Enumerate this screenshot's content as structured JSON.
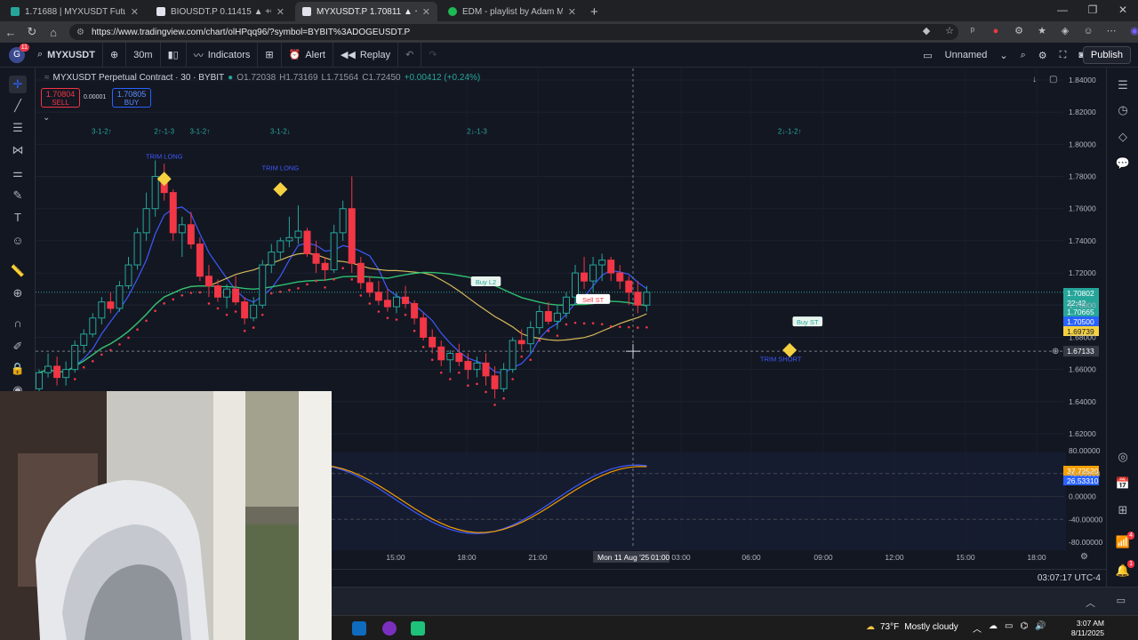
{
  "browser": {
    "tabs": [
      {
        "title": "1.71688 | MYXUSDT Futures Exch...",
        "color": "#26a69a",
        "active": false
      },
      {
        "title": "BIOUSDT.P 0.11415 ▲ +0.22% Un...",
        "color": "#ffffff",
        "active": false
      },
      {
        "title": "MYXUSDT.P 1.70811 ▲ +2.28% U...",
        "color": "#ffffff",
        "active": true
      },
      {
        "title": "EDM - playlist by Adam Moss | Sp...",
        "color": "#1db954",
        "active": false
      }
    ],
    "url": "https://www.tradingview.com/chart/olHPqq96/?symbol=BYBIT%3ADOGEUSDT.P"
  },
  "toolbar": {
    "avatar_letter": "G",
    "avatar_badge": "11",
    "symbol": "MYXUSDT",
    "interval": "30m",
    "indicators": "Indicators",
    "alert": "Alert",
    "replay": "Replay",
    "layout_name": "Unnamed",
    "publish": "Publish"
  },
  "legend": {
    "title": "MYXUSDT Perpetual Contract · 30 · BYBIT",
    "open": "O1.72038",
    "high": "H1.73169",
    "low": "L1.71564",
    "close": "C1.72450",
    "change": "+0.00412 (+0.24%)"
  },
  "trade": {
    "sell_price": "1.70804",
    "sell_label": "SELL",
    "spread": "0.00001",
    "buy_price": "1.70805",
    "buy_label": "BUY"
  },
  "chart_data": {
    "type": "candlestick",
    "price_axis": [
      "1.84000",
      "1.82000",
      "1.80000",
      "1.78000",
      "1.76000",
      "1.74000",
      "1.72000",
      "1.70000",
      "1.68000",
      "1.66000",
      "1.64000",
      "1.62000"
    ],
    "time_axis": [
      "15:00",
      "18:00",
      "21:00",
      "01:00",
      "03:00",
      "06:00",
      "09:00",
      "12:00",
      "15:00",
      "18:00"
    ],
    "crosshair_date": "Mon 11 Aug '25",
    "crosshair_time": "01:00",
    "crosshair_price": "1.67133",
    "price_labels": [
      {
        "value": "1.70802",
        "color": "#26a69a"
      },
      {
        "value": "22:42",
        "color": "#26a69a"
      },
      {
        "value": "1.70665",
        "color": "#26a69a"
      },
      {
        "value": "1.70500",
        "color": "#2962ff"
      },
      {
        "value": "1.69739",
        "color": "#f5d142"
      }
    ],
    "pattern_labels": [
      {
        "text": "3-1-2↑",
        "t": 7,
        "p": 1.8065
      },
      {
        "text": "2↑-1-3",
        "t": 14,
        "p": 1.8065
      },
      {
        "text": "3-1-2↑",
        "t": 18,
        "p": 1.8065
      },
      {
        "text": "3-1-2↓",
        "t": 27,
        "p": 1.8065
      },
      {
        "text": "2↓-1-3",
        "t": 49,
        "p": 1.8065
      },
      {
        "text": "2↓-1-2↑",
        "t": 84,
        "p": 1.8065
      }
    ],
    "annotations": [
      {
        "text": "TRIM LONG",
        "t": 14,
        "p": 1.791
      },
      {
        "text": "TRIM LONG",
        "t": 27,
        "p": 1.784
      },
      {
        "text": "Buy L2",
        "t": 50,
        "p": 1.714
      },
      {
        "text": "Sell ST",
        "t": 62,
        "p": 1.703
      },
      {
        "text": "Buy ST",
        "t": 86,
        "p": 1.689
      },
      {
        "text": "TRIM SHORT",
        "t": 83,
        "p": 1.665
      }
    ],
    "diamonds": [
      {
        "t": 14,
        "p": 1.7785
      },
      {
        "t": 27,
        "p": 1.772
      },
      {
        "t": 84,
        "p": 1.672
      }
    ],
    "candles": [
      [
        1.648,
        1.66,
        1.645,
        1.658
      ],
      [
        1.658,
        1.67,
        1.655,
        1.662
      ],
      [
        1.662,
        1.668,
        1.65,
        1.655
      ],
      [
        1.655,
        1.665,
        1.65,
        1.66
      ],
      [
        1.66,
        1.678,
        1.658,
        1.675
      ],
      [
        1.675,
        1.685,
        1.67,
        1.682
      ],
      [
        1.682,
        1.695,
        1.68,
        1.692
      ],
      [
        1.692,
        1.705,
        1.688,
        1.702
      ],
      [
        1.702,
        1.708,
        1.695,
        1.698
      ],
      [
        1.698,
        1.715,
        1.696,
        1.712
      ],
      [
        1.712,
        1.73,
        1.71,
        1.725
      ],
      [
        1.725,
        1.748,
        1.722,
        1.745
      ],
      [
        1.745,
        1.77,
        1.74,
        1.76
      ],
      [
        1.76,
        1.79,
        1.755,
        1.78
      ],
      [
        1.78,
        1.788,
        1.765,
        1.77
      ],
      [
        1.77,
        1.772,
        1.74,
        1.745
      ],
      [
        1.745,
        1.755,
        1.73,
        1.75
      ],
      [
        1.75,
        1.758,
        1.735,
        1.738
      ],
      [
        1.738,
        1.742,
        1.715,
        1.718
      ],
      [
        1.718,
        1.725,
        1.705,
        1.712
      ],
      [
        1.712,
        1.716,
        1.702,
        1.705
      ],
      [
        1.705,
        1.713,
        1.698,
        1.71
      ],
      [
        1.71,
        1.718,
        1.7,
        1.702
      ],
      [
        1.702,
        1.705,
        1.688,
        1.692
      ],
      [
        1.692,
        1.705,
        1.69,
        1.7
      ],
      [
        1.7,
        1.728,
        1.698,
        1.725
      ],
      [
        1.725,
        1.738,
        1.72,
        1.733
      ],
      [
        1.733,
        1.742,
        1.728,
        1.74
      ],
      [
        1.74,
        1.755,
        1.736,
        1.742
      ],
      [
        1.742,
        1.762,
        1.738,
        1.746
      ],
      [
        1.746,
        1.748,
        1.73,
        1.732
      ],
      [
        1.732,
        1.74,
        1.72,
        1.726
      ],
      [
        1.726,
        1.73,
        1.715,
        1.722
      ],
      [
        1.722,
        1.75,
        1.72,
        1.745
      ],
      [
        1.745,
        1.765,
        1.74,
        1.76
      ],
      [
        1.76,
        1.78,
        1.72,
        1.726
      ],
      [
        1.726,
        1.73,
        1.71,
        1.714
      ],
      [
        1.714,
        1.718,
        1.705,
        1.708
      ],
      [
        1.708,
        1.715,
        1.7,
        1.703
      ],
      [
        1.703,
        1.71,
        1.696,
        1.699
      ],
      [
        1.699,
        1.708,
        1.695,
        1.705
      ],
      [
        1.705,
        1.712,
        1.698,
        1.701
      ],
      [
        1.701,
        1.703,
        1.688,
        1.692
      ],
      [
        1.692,
        1.695,
        1.678,
        1.68
      ],
      [
        1.68,
        1.685,
        1.67,
        1.674
      ],
      [
        1.674,
        1.678,
        1.662,
        1.666
      ],
      [
        1.666,
        1.672,
        1.658,
        1.67
      ],
      [
        1.67,
        1.676,
        1.662,
        1.665
      ],
      [
        1.665,
        1.67,
        1.654,
        1.66
      ],
      [
        1.66,
        1.668,
        1.655,
        1.664
      ],
      [
        1.664,
        1.67,
        1.65,
        1.656
      ],
      [
        1.656,
        1.662,
        1.642,
        1.648
      ],
      [
        1.648,
        1.664,
        1.646,
        1.66
      ],
      [
        1.66,
        1.68,
        1.658,
        1.678
      ],
      [
        1.678,
        1.685,
        1.672,
        1.676
      ],
      [
        1.676,
        1.69,
        1.67,
        1.686
      ],
      [
        1.686,
        1.7,
        1.682,
        1.696
      ],
      [
        1.696,
        1.702,
        1.688,
        1.69
      ],
      [
        1.69,
        1.7,
        1.685,
        1.695
      ],
      [
        1.695,
        1.708,
        1.692,
        1.705
      ],
      [
        1.705,
        1.725,
        1.7,
        1.72
      ],
      [
        1.72,
        1.73,
        1.71,
        1.715
      ],
      [
        1.715,
        1.73,
        1.708,
        1.725
      ],
      [
        1.725,
        1.732,
        1.715,
        1.728
      ],
      [
        1.728,
        1.73,
        1.715,
        1.72
      ],
      [
        1.72,
        1.725,
        1.71,
        1.715
      ],
      [
        1.715,
        1.718,
        1.7,
        1.708
      ],
      [
        1.708,
        1.715,
        1.695,
        1.7
      ],
      [
        1.7,
        1.712,
        1.696,
        1.708
      ]
    ],
    "oscillator_axis": [
      "80.00000",
      "40.00000",
      "0.00000",
      "-40.00000",
      "-80.00000"
    ],
    "oscillator_labels": [
      {
        "value": "37.72520",
        "color": "#f59f00"
      },
      {
        "value": "26.53310",
        "color": "#2962ff"
      }
    ]
  },
  "bottom": {
    "clock": "03:07:17 UTC-4"
  },
  "taskbar": {
    "temp": "73°F",
    "weather": "Mostly cloudy",
    "time": "3:07 AM",
    "date": "8/11/2025"
  }
}
